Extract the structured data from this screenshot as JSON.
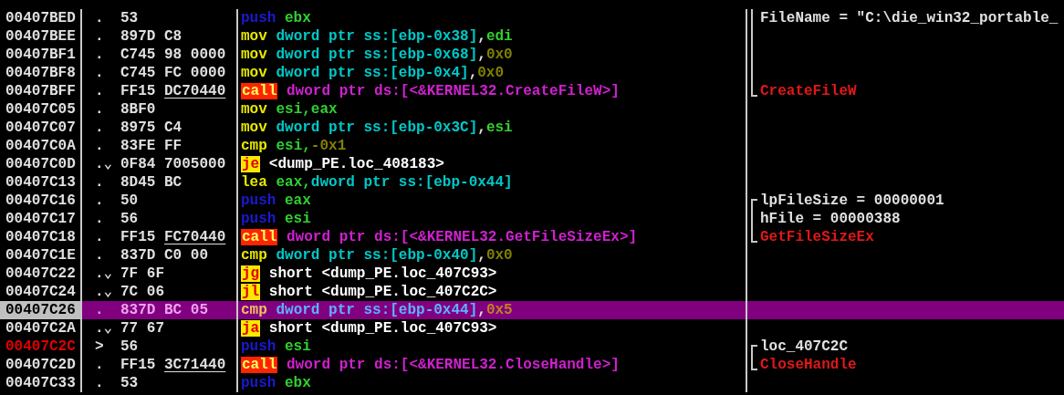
{
  "disassembly": {
    "rows": [
      {
        "address": "00407BED",
        "jump_target": false,
        "selected": false,
        "marker": ".",
        "bytes": [
          "53"
        ],
        "underlined": false,
        "instruction": [
          {
            "kind": "push",
            "text": "push"
          },
          {
            "kind": "reg",
            "text": "ebx"
          }
        ],
        "comment": {
          "text": "FileName = \"C:\\die_win32_portable_",
          "color": "#e0e0e0",
          "kind": "mid"
        }
      },
      {
        "address": "00407BEE",
        "jump_target": false,
        "selected": false,
        "marker": ".",
        "bytes": [
          "897D",
          "C8"
        ],
        "underlined": false,
        "instruction": [
          {
            "kind": "mnemonic",
            "text": "mov"
          },
          {
            "kind": "mem",
            "text": "dword ptr ss:[ebp-0x38]"
          },
          {
            "kind": "punct",
            "text": ","
          },
          {
            "kind": "reg",
            "text": "edi"
          }
        ],
        "comment": {
          "kind": "mid"
        }
      },
      {
        "address": "00407BF1",
        "jump_target": false,
        "selected": false,
        "marker": ".",
        "bytes": [
          "C745",
          "98",
          "0000"
        ],
        "underlined": false,
        "instruction": [
          {
            "kind": "mnemonic",
            "text": "mov"
          },
          {
            "kind": "mem",
            "text": "dword ptr ss:[ebp-0x68]"
          },
          {
            "kind": "punct",
            "text": ","
          },
          {
            "kind": "imm",
            "text": "0x0"
          }
        ],
        "comment": {
          "kind": "mid"
        }
      },
      {
        "address": "00407BF8",
        "jump_target": false,
        "selected": false,
        "marker": ".",
        "bytes": [
          "C745",
          "FC",
          "0000"
        ],
        "underlined": false,
        "instruction": [
          {
            "kind": "mnemonic",
            "text": "mov"
          },
          {
            "kind": "mem",
            "text": "dword ptr ss:[ebp-0x4]"
          },
          {
            "kind": "punct",
            "text": ","
          },
          {
            "kind": "imm",
            "text": "0x0"
          }
        ],
        "comment": {
          "kind": "mid"
        }
      },
      {
        "address": "00407BFF",
        "jump_target": false,
        "selected": false,
        "marker": ".",
        "bytes": [
          "FF15",
          "DC70440"
        ],
        "underlined": true,
        "instruction": [
          {
            "kind": "call",
            "text": "call"
          },
          {
            "kind": "api",
            "text": "dword ptr ds:[<&KERNEL32.CreateFileW>]"
          }
        ],
        "comment": {
          "text": "CreateFileW",
          "color": "#e01818",
          "kind": "end"
        }
      },
      {
        "address": "00407C05",
        "jump_target": false,
        "selected": false,
        "marker": ".",
        "bytes": [
          "8BF0"
        ],
        "underlined": false,
        "instruction": [
          {
            "kind": "mnemonic",
            "text": "mov"
          },
          {
            "kind": "reg",
            "text": "esi,eax"
          }
        ]
      },
      {
        "address": "00407C07",
        "jump_target": false,
        "selected": false,
        "marker": ".",
        "bytes": [
          "8975",
          "C4"
        ],
        "underlined": false,
        "instruction": [
          {
            "kind": "mnemonic",
            "text": "mov"
          },
          {
            "kind": "mem",
            "text": "dword ptr ss:[ebp-0x3C]"
          },
          {
            "kind": "punct",
            "text": ","
          },
          {
            "kind": "reg",
            "text": "esi"
          }
        ]
      },
      {
        "address": "00407C0A",
        "jump_target": false,
        "selected": false,
        "marker": ".",
        "bytes": [
          "83FE",
          "FF"
        ],
        "underlined": false,
        "instruction": [
          {
            "kind": "mnemonic",
            "text": "cmp"
          },
          {
            "kind": "reg",
            "text": "esi,"
          },
          {
            "kind": "imm",
            "text": "-0x1"
          }
        ]
      },
      {
        "address": "00407C0D",
        "jump_target": false,
        "selected": false,
        "marker": ".⌄",
        "bytes": [
          "0F84",
          "7005000"
        ],
        "underlined": false,
        "instruction": [
          {
            "kind": "jump",
            "text": "je"
          },
          {
            "kind": "target",
            "text": "<dump_PE.loc_408183>"
          }
        ]
      },
      {
        "address": "00407C13",
        "jump_target": false,
        "selected": false,
        "marker": ".",
        "bytes": [
          "8D45",
          "BC"
        ],
        "underlined": false,
        "instruction": [
          {
            "kind": "mnemonic",
            "text": "lea"
          },
          {
            "kind": "reg",
            "text": "eax,"
          },
          {
            "kind": "mem",
            "text": "dword ptr ss:[ebp-0x44]"
          }
        ]
      },
      {
        "address": "00407C16",
        "jump_target": false,
        "selected": false,
        "marker": ".",
        "bytes": [
          "50"
        ],
        "underlined": false,
        "instruction": [
          {
            "kind": "push",
            "text": "push"
          },
          {
            "kind": "reg",
            "text": "eax"
          }
        ],
        "comment": {
          "text": "lpFileSize = 00000001",
          "color": "#e0e0e0",
          "kind": "start"
        }
      },
      {
        "address": "00407C17",
        "jump_target": false,
        "selected": false,
        "marker": ".",
        "bytes": [
          "56"
        ],
        "underlined": false,
        "instruction": [
          {
            "kind": "push",
            "text": "push"
          },
          {
            "kind": "reg",
            "text": "esi"
          }
        ],
        "comment": {
          "text": "hFile = 00000388",
          "color": "#e0e0e0",
          "kind": "mid"
        }
      },
      {
        "address": "00407C18",
        "jump_target": false,
        "selected": false,
        "marker": ".",
        "bytes": [
          "FF15",
          "FC70440"
        ],
        "underlined": true,
        "instruction": [
          {
            "kind": "call",
            "text": "call"
          },
          {
            "kind": "api",
            "text": "dword ptr ds:[<&KERNEL32.GetFileSizeEx>]"
          }
        ],
        "comment": {
          "text": "GetFileSizeEx",
          "color": "#e01818",
          "kind": "end"
        }
      },
      {
        "address": "00407C1E",
        "jump_target": false,
        "selected": false,
        "marker": ".",
        "bytes": [
          "837D",
          "C0",
          "00"
        ],
        "underlined": false,
        "instruction": [
          {
            "kind": "mnemonic",
            "text": "cmp"
          },
          {
            "kind": "mem",
            "text": "dword ptr ss:[ebp-0x40]"
          },
          {
            "kind": "punct",
            "text": ","
          },
          {
            "kind": "imm",
            "text": "0x0"
          }
        ]
      },
      {
        "address": "00407C22",
        "jump_target": false,
        "selected": false,
        "marker": ".⌄",
        "bytes": [
          "7F",
          "6F"
        ],
        "underlined": false,
        "instruction": [
          {
            "kind": "jump",
            "text": "jg"
          },
          {
            "kind": "target",
            "text": "short <dump_PE.loc_407C93>"
          }
        ]
      },
      {
        "address": "00407C24",
        "jump_target": false,
        "selected": false,
        "marker": ".⌄",
        "bytes": [
          "7C",
          "06"
        ],
        "underlined": false,
        "instruction": [
          {
            "kind": "jump",
            "text": "jl"
          },
          {
            "kind": "target",
            "text": "short <dump_PE.loc_407C2C>"
          }
        ]
      },
      {
        "address": "00407C26",
        "jump_target": false,
        "selected": true,
        "marker": ".",
        "bytes": [
          "837D",
          "BC",
          "05"
        ],
        "underlined": false,
        "instruction": [
          {
            "kind": "mnemonic",
            "text": "cmp"
          },
          {
            "kind": "mem",
            "text": "dword ptr ss:[ebp-0x44]"
          },
          {
            "kind": "punct",
            "text": ","
          },
          {
            "kind": "imm",
            "text": "0x5"
          }
        ]
      },
      {
        "address": "00407C2A",
        "jump_target": false,
        "selected": false,
        "marker": ".⌄",
        "bytes": [
          "77",
          "67"
        ],
        "underlined": false,
        "instruction": [
          {
            "kind": "jump",
            "text": "ja"
          },
          {
            "kind": "target",
            "text": "short <dump_PE.loc_407C93>"
          }
        ]
      },
      {
        "address": "00407C2C",
        "jump_target": true,
        "selected": false,
        "marker": ">",
        "bytes": [
          "56"
        ],
        "underlined": false,
        "instruction": [
          {
            "kind": "push",
            "text": "push"
          },
          {
            "kind": "reg",
            "text": "esi"
          }
        ],
        "comment": {
          "text": "loc_407C2C",
          "color": "#e0e0e0",
          "kind": "start"
        }
      },
      {
        "address": "00407C2D",
        "jump_target": false,
        "selected": false,
        "marker": ".",
        "bytes": [
          "FF15",
          "3C71440"
        ],
        "underlined": true,
        "instruction": [
          {
            "kind": "call",
            "text": "call"
          },
          {
            "kind": "api",
            "text": "dword ptr ds:[<&KERNEL32.CloseHandle>]"
          }
        ],
        "comment": {
          "text": "CloseHandle",
          "color": "#e01818",
          "kind": "end"
        }
      },
      {
        "address": "00407C33",
        "jump_target": false,
        "selected": false,
        "marker": ".",
        "bytes": [
          "53"
        ],
        "underlined": false,
        "instruction": [
          {
            "kind": "push",
            "text": "push"
          },
          {
            "kind": "reg",
            "text": "ebx"
          }
        ]
      }
    ]
  }
}
